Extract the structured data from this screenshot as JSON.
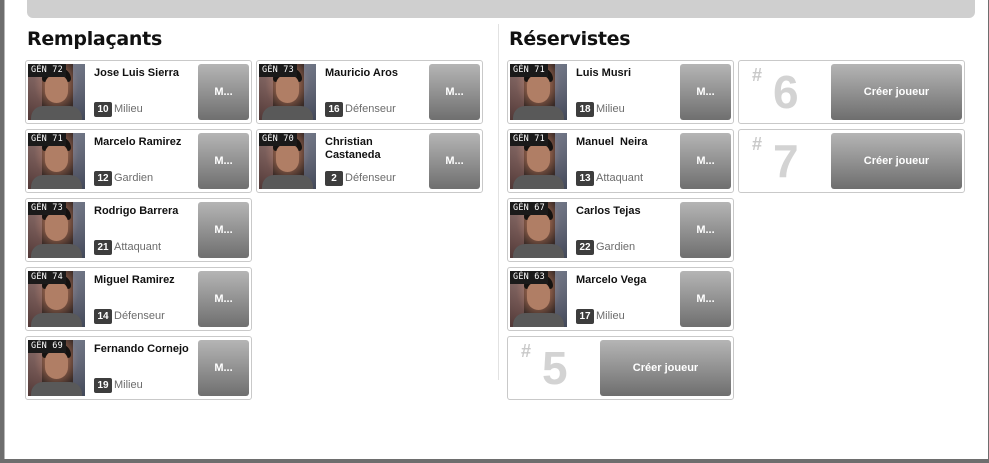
{
  "sections": {
    "remplacants": {
      "title": "Remplaçants"
    },
    "reservistes": {
      "title": "Réservistes"
    }
  },
  "remplacants": [
    {
      "gen": "GÉN 72",
      "name": "Jose Luis Sierra",
      "number": "10",
      "position": "Milieu",
      "action": "M..."
    },
    {
      "gen": "GÉN 73",
      "name": "Mauricio Aros",
      "number": "16",
      "position": "Défenseur",
      "action": "M..."
    },
    {
      "gen": "GÉN 71",
      "name": "Marcelo Ramirez",
      "number": "12",
      "position": "Gardien",
      "action": "M..."
    },
    {
      "gen": "GÉN 70",
      "name": "Christian Castaneda",
      "number": "2",
      "position": "Défenseur",
      "action": "M..."
    },
    {
      "gen": "GÉN 73",
      "name": "Rodrigo Barrera",
      "number": "21",
      "position": "Attaquant",
      "action": "M..."
    },
    {
      "gen": "GÉN 74",
      "name": "Miguel Ramirez",
      "number": "14",
      "position": "Défenseur",
      "action": "M..."
    },
    {
      "gen": "GÉN 69",
      "name": "Fernando Cornejo",
      "number": "19",
      "position": "Milieu",
      "action": "M..."
    }
  ],
  "reservistes": [
    {
      "gen": "GÉN 71",
      "name": "Luis Musri",
      "number": "18",
      "position": "Milieu",
      "action": "M..."
    },
    {
      "gen": "GÉN 71",
      "name": "Manuel  Neira",
      "number": "13",
      "position": "Attaquant",
      "action": "M..."
    },
    {
      "gen": "GÉN 67",
      "name": "Carlos Tejas",
      "number": "22",
      "position": "Gardien",
      "action": "M..."
    },
    {
      "gen": "GÉN 63",
      "name": "Marcelo Vega",
      "number": "17",
      "position": "Milieu",
      "action": "M..."
    }
  ],
  "empty_slots": [
    {
      "hash": "#",
      "number": "6",
      "button": "Créer joueur"
    },
    {
      "hash": "#",
      "number": "7",
      "button": "Créer joueur"
    },
    {
      "hash": "#",
      "number": "5",
      "button": "Créer joueur"
    }
  ]
}
